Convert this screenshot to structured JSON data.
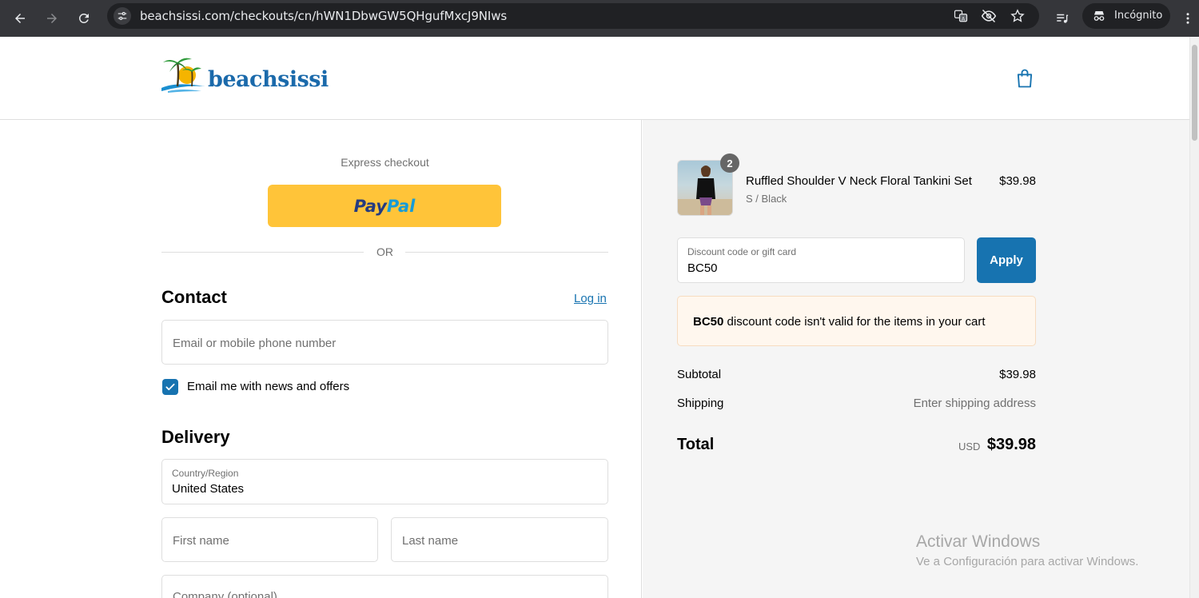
{
  "browser": {
    "url": "beachsissi.com/checkouts/cn/hWN1DbwGW5QHgufMxcJ9NIws",
    "incognito_label": "Incógnito"
  },
  "header": {
    "logo_text": "beachsissi"
  },
  "checkout": {
    "express_label": "Express checkout",
    "paypal_part1": "Pay",
    "paypal_part2": "Pal",
    "or_label": "OR",
    "contact_heading": "Contact",
    "login_link": "Log in",
    "email_placeholder": "Email or mobile phone number",
    "news_checkbox_label": "Email me with news and offers",
    "news_checked": true,
    "delivery_heading": "Delivery",
    "country_label": "Country/Region",
    "country_value": "United States",
    "first_name_placeholder": "First name",
    "last_name_placeholder": "Last name",
    "company_placeholder": "Company (optional)"
  },
  "summary": {
    "item": {
      "quantity": "2",
      "name": "Ruffled Shoulder V Neck Floral Tankini Set",
      "variant": "S / Black",
      "price": "$39.98"
    },
    "discount_label": "Discount code or gift card",
    "discount_value": "BC50",
    "apply_label": "Apply",
    "notice_code": "BC50",
    "notice_text": " discount code isn't valid for the items in your cart",
    "subtotal_label": "Subtotal",
    "subtotal_value": "$39.98",
    "shipping_label": "Shipping",
    "shipping_value": "Enter shipping address",
    "total_label": "Total",
    "total_currency": "USD",
    "total_value": "$39.98"
  },
  "watermark": {
    "line1": "Activar Windows",
    "line2": "Ve a Configuración para activar Windows."
  },
  "colors": {
    "accent": "#1773b0",
    "paypal_yellow": "#ffc439",
    "chrome_bg": "#35363a"
  }
}
